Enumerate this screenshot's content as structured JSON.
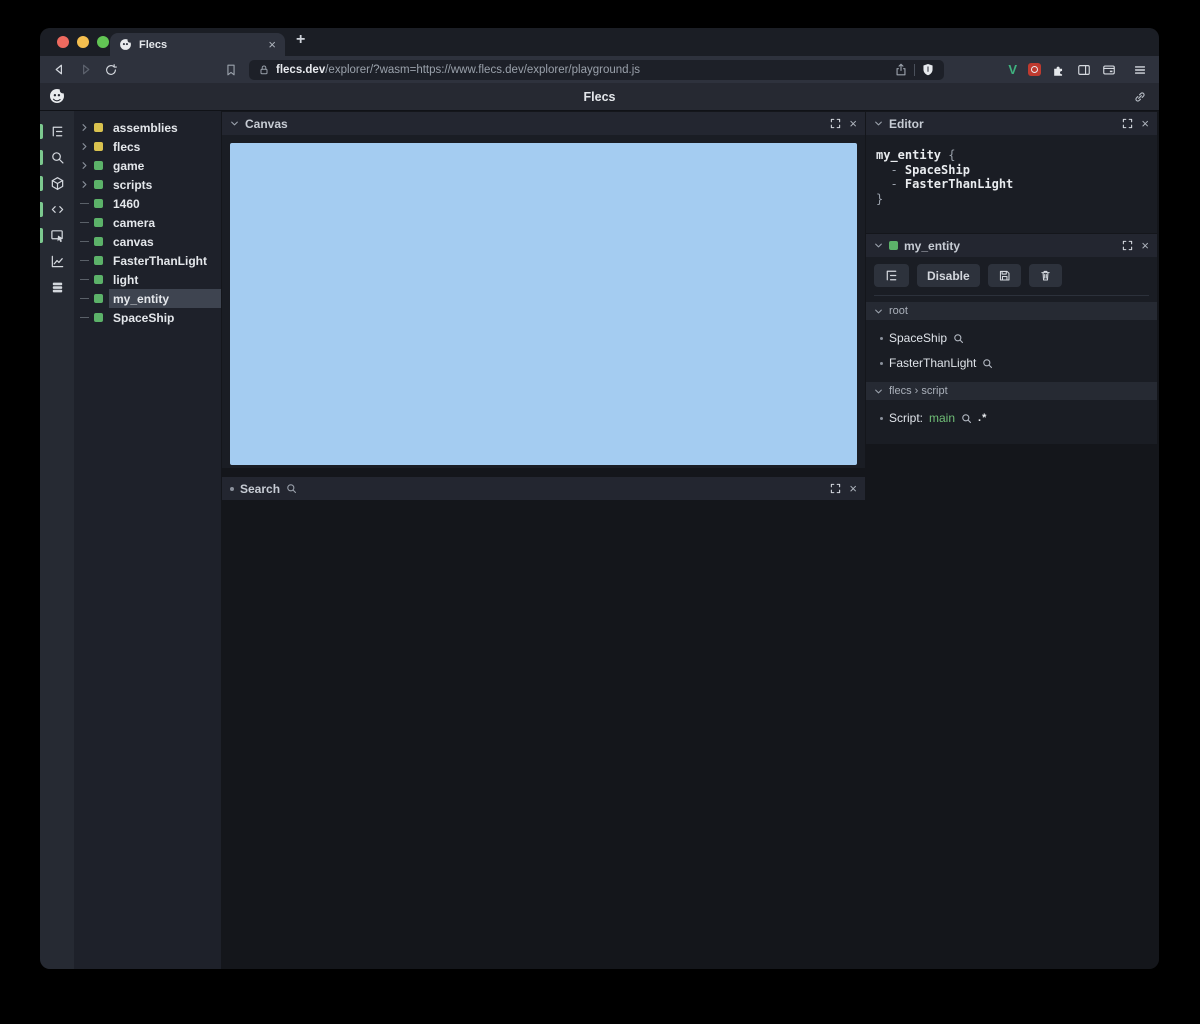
{
  "ui": {
    "close_glyph": "×"
  },
  "colors": {
    "canvas_blue": "#a4ccf1",
    "entity_green": "#5cb269",
    "module_yellow": "#d9c24f",
    "script_value_green": "#6fbe76",
    "vue_badge_green": "#3fb27f",
    "traffic_red": "#ee6a5f",
    "traffic_yellow": "#f5bf4f",
    "traffic_green": "#62c554"
  },
  "browser": {
    "tab": {
      "title": "Flecs"
    },
    "new_tab_label": "+",
    "url": {
      "domain": "flecs.dev",
      "path": "/explorer/?wasm=https://www.flecs.dev/explorer/playground.js"
    },
    "extensions_v_label": "V"
  },
  "app": {
    "title": "Flecs"
  },
  "rail": {
    "items": [
      {
        "name": "tree-view",
        "icon": "list-tree",
        "active": true
      },
      {
        "name": "query",
        "icon": "search",
        "active": true
      },
      {
        "name": "entities",
        "icon": "cube",
        "active": true
      },
      {
        "name": "code",
        "icon": "code",
        "active": true
      },
      {
        "name": "inspector",
        "icon": "inspect",
        "active": true
      },
      {
        "name": "statistics",
        "icon": "chart",
        "active": false
      },
      {
        "name": "commands",
        "icon": "stack",
        "active": false
      }
    ]
  },
  "tree": {
    "items": [
      {
        "label": "assemblies",
        "color": "#d9c24f",
        "expandable": true,
        "selected": false
      },
      {
        "label": "flecs",
        "color": "#d9c24f",
        "expandable": true,
        "selected": false
      },
      {
        "label": "game",
        "color": "#5cb269",
        "expandable": true,
        "selected": false
      },
      {
        "label": "scripts",
        "color": "#5cb269",
        "expandable": true,
        "selected": false
      },
      {
        "label": "1460",
        "color": "#5cb269",
        "expandable": false,
        "selected": false
      },
      {
        "label": "camera",
        "color": "#5cb269",
        "expandable": false,
        "selected": false
      },
      {
        "label": "canvas",
        "color": "#5cb269",
        "expandable": false,
        "selected": false
      },
      {
        "label": "FasterThanLight",
        "color": "#5cb269",
        "expandable": false,
        "selected": false
      },
      {
        "label": "light",
        "color": "#5cb269",
        "expandable": false,
        "selected": false
      },
      {
        "label": "my_entity",
        "color": "#5cb269",
        "expandable": false,
        "selected": true
      },
      {
        "label": "SpaceShip",
        "color": "#5cb269",
        "expandable": false,
        "selected": false
      }
    ]
  },
  "canvas_panel": {
    "title": "Canvas",
    "canvas_color": "#a4ccf1"
  },
  "search_panel": {
    "title": "Search"
  },
  "editor_panel": {
    "title": "Editor",
    "code_lines": [
      {
        "segments": [
          {
            "text": "my_entity",
            "style": "ident"
          },
          {
            "text": " {",
            "style": "punct"
          }
        ]
      },
      {
        "segments": [
          {
            "text": "  - ",
            "style": "punct"
          },
          {
            "text": "SpaceShip",
            "style": "ident"
          }
        ]
      },
      {
        "segments": [
          {
            "text": "  - ",
            "style": "punct"
          },
          {
            "text": "FasterThanLight",
            "style": "ident"
          }
        ]
      },
      {
        "segments": [
          {
            "text": "}",
            "style": "punct"
          }
        ]
      }
    ]
  },
  "inspector_panel": {
    "title": "my_entity",
    "entity_color": "#5cb269",
    "toolbar": [
      {
        "name": "tree-toggle",
        "type": "icon",
        "icon": "list-tree"
      },
      {
        "name": "disable",
        "type": "text",
        "label": "Disable"
      },
      {
        "name": "save",
        "type": "icon",
        "icon": "floppy"
      },
      {
        "name": "delete",
        "type": "icon",
        "icon": "trash"
      }
    ],
    "sections": [
      {
        "title": "root",
        "items": [
          {
            "segments": [
              {
                "text": "SpaceShip",
                "style": "plain"
              }
            ],
            "icons": [
              "search"
            ]
          },
          {
            "segments": [
              {
                "text": "FasterThanLight",
                "style": "plain"
              }
            ],
            "icons": [
              "search"
            ]
          }
        ]
      },
      {
        "title": "flecs › script",
        "items": [
          {
            "segments": [
              {
                "text": "Script: ",
                "style": "plain"
              },
              {
                "text": "main",
                "style": "green"
              }
            ],
            "icons": [
              "search",
              "regex"
            ]
          }
        ]
      }
    ]
  }
}
